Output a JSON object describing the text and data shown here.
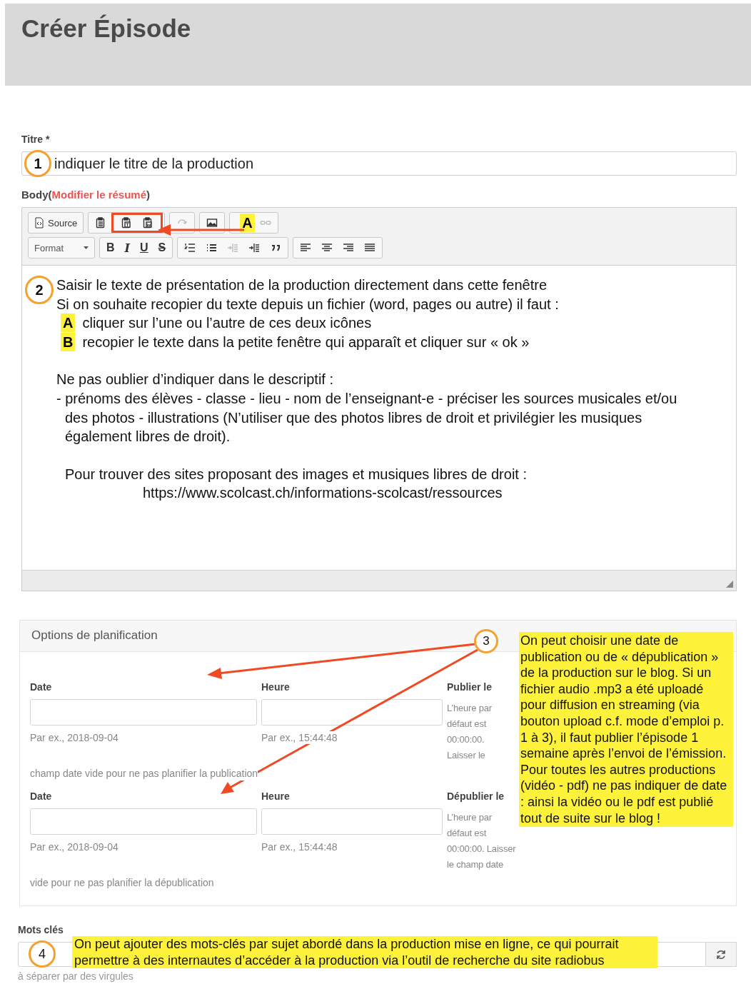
{
  "page_title": "Créer Épisode",
  "title_field": {
    "label": "Titre *",
    "marker": "1",
    "value": "indiquer le titre de la production"
  },
  "body_label": {
    "before": "Body(",
    "link": "Modifier le résumé",
    "after": ")"
  },
  "editor": {
    "toolbar_rows": [
      [
        [
          {
            "kind": "source",
            "label": "Source",
            "disabled": false
          }
        ],
        [
          {
            "kind": "paste",
            "disabled": false
          },
          {
            "kind": "highlight-frame",
            "items": [
              {
                "kind": "paste-text",
                "disabled": false
              },
              {
                "kind": "paste-word",
                "disabled": false
              }
            ]
          }
        ],
        [
          {
            "kind": "redo",
            "disabled": true
          }
        ],
        [
          {
            "kind": "image",
            "disabled": false
          }
        ],
        [
          {
            "kind": "unlink",
            "disabled": true
          }
        ]
      ],
      [
        [
          {
            "kind": "format",
            "label": "Format",
            "disabled": false
          }
        ],
        [
          {
            "kind": "bold",
            "label": "B",
            "disabled": false
          },
          {
            "kind": "italic",
            "label": "I",
            "disabled": false
          },
          {
            "kind": "underline",
            "label": "U",
            "disabled": false
          },
          {
            "kind": "strike",
            "label": "S",
            "disabled": false
          }
        ],
        [
          {
            "kind": "ordered-list",
            "disabled": false
          },
          {
            "kind": "bullet-list",
            "disabled": false
          },
          {
            "kind": "outdent",
            "disabled": true
          },
          {
            "kind": "indent",
            "disabled": false
          },
          {
            "kind": "blockquote",
            "disabled": false
          }
        ],
        [
          {
            "kind": "align-left",
            "disabled": false
          },
          {
            "kind": "align-center",
            "disabled": false
          },
          {
            "kind": "align-right",
            "disabled": false
          },
          {
            "kind": "justify",
            "disabled": false
          }
        ]
      ]
    ],
    "callout_letter": "A",
    "content": {
      "marker": "2",
      "intro": [
        "Saisir le texte de présentation de la production directement dans cette fenêtre",
        "Si on souhaite recopier du texte depuis un fichier (word, pages ou autre) il faut :"
      ],
      "steps": [
        {
          "letter": "A",
          "text": "cliquer sur l’une ou l’autre de ces deux icônes"
        },
        {
          "letter": "B",
          "text": "recopier le texte dans la petite fenêtre qui apparaît et cliquer sur « ok »"
        }
      ],
      "reminder_lead": "Ne pas oublier d’indiquer dans le descriptif :",
      "reminder_item": "- prénoms des élèves - classe - lieu - nom de l’enseignant-e - préciser les sources musicales et/ou des photos - illustrations (N’utiliser que des photos libres de droit et privilégier les musiques également libres de droit).",
      "resources_text": "Pour trouver des sites proposant des images et musiques libres de droit :",
      "resources_url": "https://www.scolcast.ch/informations-scolcast/ressources"
    }
  },
  "scheduling": {
    "title": "Options de planification",
    "marker": "3",
    "rows": [
      {
        "date_label": "Date",
        "time_label": "Heure",
        "side_label": "Publier le",
        "date_hint": "Par ex., 2018-09-04",
        "time_hint": "Par ex., 15:44:48",
        "side_hint": [
          "L’heure par",
          "défaut est",
          "00:00:00.",
          "Laisser le"
        ],
        "footer": "champ date vide pour ne pas planifier la publication"
      },
      {
        "date_label": "Date",
        "time_label": "Heure",
        "side_label": "Dépublier le",
        "date_hint": "Par ex., 2018-09-04",
        "time_hint": "Par ex., 15:44:48",
        "side_hint": [
          "L’heure par",
          "défaut est",
          "00:00:00. Laisser",
          "le champ date"
        ],
        "footer": "vide pour ne pas planifier la dépublication"
      }
    ],
    "note": [
      "On peut choisir une date de publication ou de « dépublication » de la production sur le blog. Si un fichier audio  .mp3 a été uploadé pour diffusion en streaming (via bouton upload c.f. mode d’emploi p. 1 à 3), il faut publier l’épisode 1 semaine après l’envoi de l’émission.",
      "Pour toutes les autres productions (vidéo - pdf) ne pas indiquer de date : ainsi la vidéo ou le pdf est publié tout de suite sur le blog !"
    ]
  },
  "keywords": {
    "label": "Mots clés",
    "marker": "4",
    "note": "On peut ajouter des mots-clés par sujet abordé dans la production mise en ligne, ce qui pourrait permettre à des internautes d’accéder à la production via l’outil de recherche du site radiobus",
    "hint": "à séparer par des virgules"
  }
}
